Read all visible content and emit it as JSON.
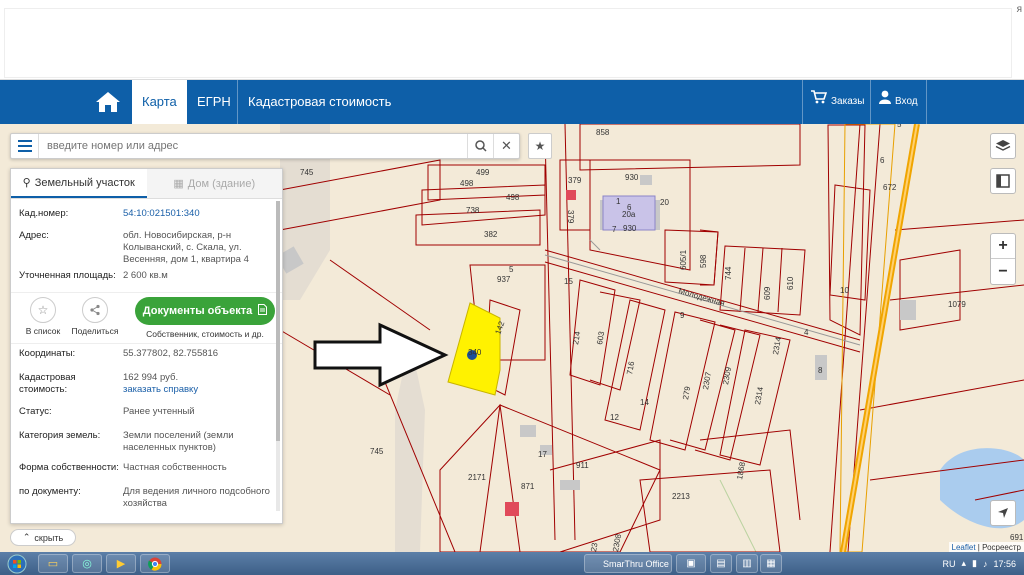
{
  "top": {
    "edge_text": "я"
  },
  "nav": {
    "tabs": [
      {
        "label": "Карта"
      },
      {
        "label": "ЕГРН"
      },
      {
        "label": "Кадастровая стоимость"
      }
    ],
    "orders": "Заказы",
    "login": "Вход"
  },
  "search": {
    "placeholder": "введите номер или адрес"
  },
  "panel": {
    "tab_land": "Земельный участок",
    "tab_building": "Дом (здание)",
    "fields": [
      {
        "key": "Кад.номер:",
        "value": "54:10:021501:340"
      },
      {
        "key": "Адрес:",
        "value": "обл. Новосибирская, р-н Колыванский, с. Скала, ул. Весенняя, дом 1, квартира 4"
      },
      {
        "key": "Уточненная площадь:",
        "value": "2 600 кв.м"
      }
    ],
    "actions": {
      "to_list": "В список",
      "share": "Поделиться",
      "docs_button": "Документы объекта",
      "docs_sub": "Собственник, стоимость и др."
    },
    "details": [
      {
        "key": "Координаты:",
        "value": "55.377802, 82.755816"
      },
      {
        "key": "Кадастровая стоимость:",
        "value": "162 994 руб.",
        "link": "заказать справку"
      },
      {
        "key": "Статус:",
        "value": "Ранее учтенный"
      },
      {
        "key": "Категория земель:",
        "value": "Земли поселений (земли населенных пунктов)"
      },
      {
        "key": "Форма собственности:",
        "value": "Частная собственность"
      },
      {
        "key": "по документу:",
        "value": "Для ведения личного подсобного хозяйства"
      }
    ],
    "collapse": "скрыть"
  },
  "map": {
    "street": "Молодежная",
    "labels": [
      "858",
      "745",
      "499",
      "498",
      "498",
      "379",
      "930",
      "738",
      "382",
      "379",
      "930",
      "20a",
      "937",
      "5",
      "15",
      "142",
      "214",
      "603",
      "716",
      "279",
      "2307",
      "2309",
      "2314",
      "2314",
      "605/1",
      "598",
      "744",
      "609",
      "610",
      "6",
      "672",
      "10",
      "1079",
      "911",
      "2171",
      "871",
      "2213",
      "1868",
      "745",
      "691",
      "12",
      "14",
      "8",
      "9",
      "17",
      "7",
      "6",
      "5",
      "4",
      "1",
      "20",
      "23",
      "2308",
      "340"
    ],
    "attribution_leaflet": "Leaflet",
    "attribution_rest": "Росреестр"
  },
  "taskbar": {
    "app": "SmarThru Office",
    "lang": "RU",
    "time": "17:56"
  },
  "colors": {
    "nav": "#0e5fa8",
    "parcel": "#fff200",
    "green": "#3aa33a"
  }
}
